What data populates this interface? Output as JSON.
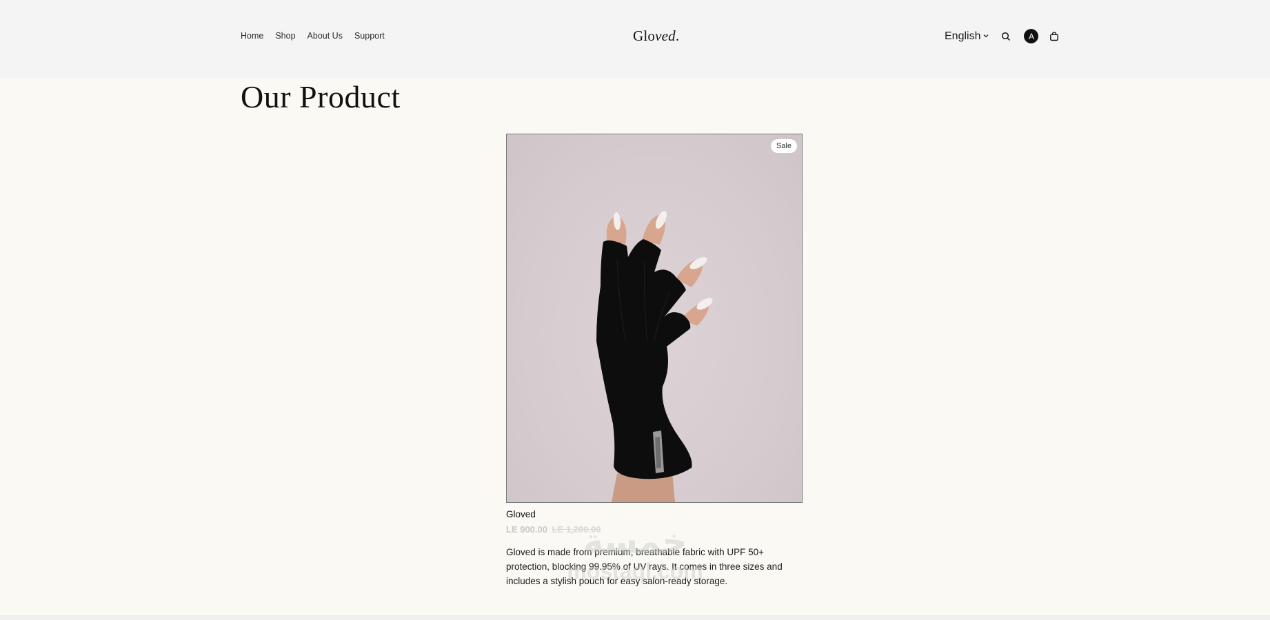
{
  "header": {
    "nav": {
      "home": "Home",
      "shop": "Shop",
      "about": "About Us",
      "support": "Support"
    },
    "logo_main": "Glo",
    "logo_italic": "ved",
    "logo_dot": ".",
    "language": "English",
    "avatar_initial": "A",
    "icons": {
      "language_dropdown": "chevron-down-icon",
      "search": "search-icon",
      "cart": "shopping-bag-icon"
    }
  },
  "main": {
    "title": "Our Product",
    "product": {
      "badge": "Sale",
      "name": "Gloved",
      "price": "LE 900.00",
      "old_price": "LE 1,200.00",
      "description": "Gloved is made from premium, breathable fabric with UPF 50+ protection, blocking 99.95% of UV rays. It comes in three sizes and includes a stylish pouch for easy salon-ready storage."
    }
  },
  "watermark": {
    "mark": "خمسة",
    "site": "mostaql.com"
  },
  "colors": {
    "header_bg": "#f4f4f4",
    "page_bg": "#faf9f3",
    "image_bg": "#d6ccd0",
    "text": "#111111"
  }
}
